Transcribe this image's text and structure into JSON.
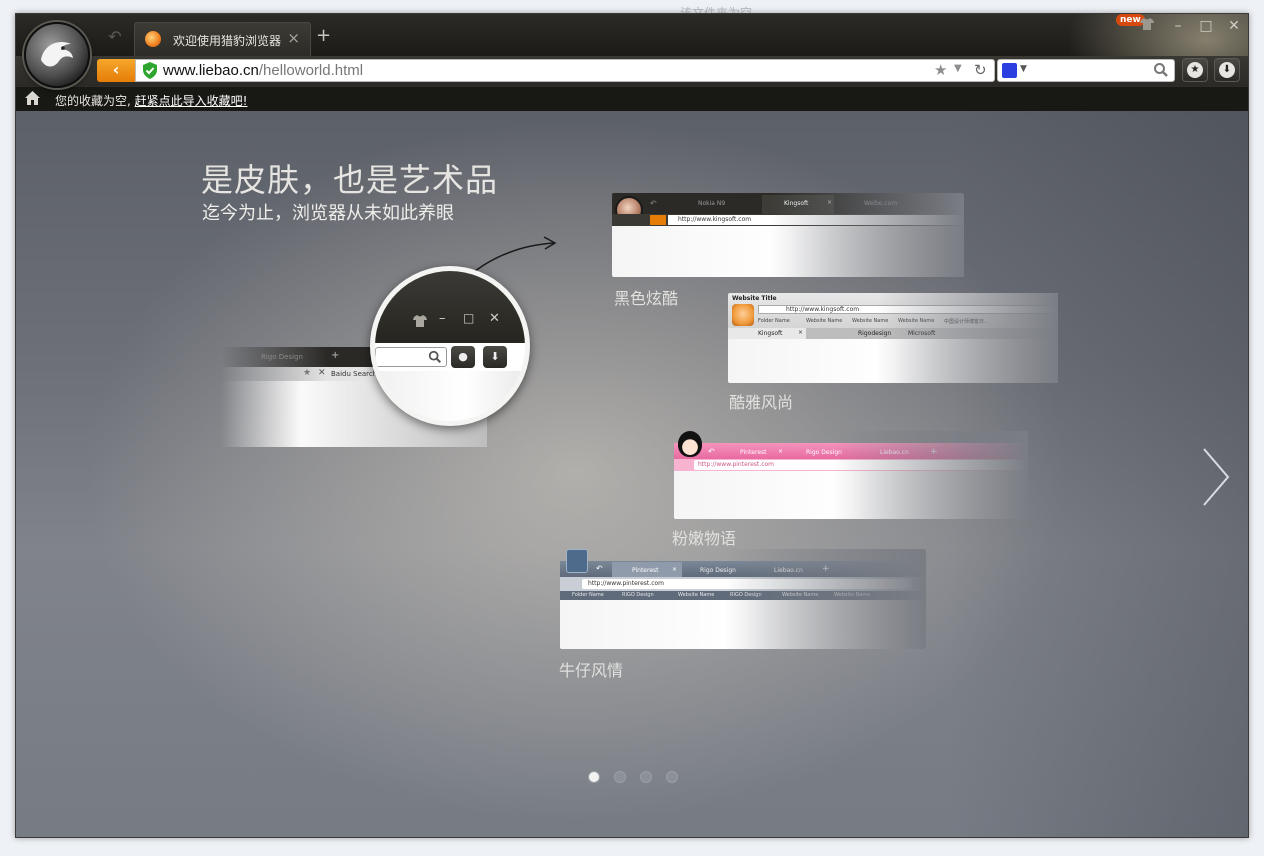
{
  "background_window_title": "该文件夹为空",
  "browser": {
    "tab": {
      "title": "欢迎使用猎豹浏览器"
    },
    "new_badge": "new",
    "address": {
      "host": "www.liebao.cn",
      "path": "/helloworld.html"
    },
    "bookmark_bar": {
      "empty_text": "您的收藏为空,",
      "import_link": "赶紧点此导入收藏吧!"
    }
  },
  "hero": {
    "headline": "是皮肤，也是艺术品",
    "subheadline": "迄今为止，浏览器从未如此养眼"
  },
  "magnifier_preview": {
    "tab_label": "Rigo Design",
    "search_label": "Baidu Search"
  },
  "skins": [
    {
      "name": "黑色炫酷",
      "tabs": [
        "Nokia N9",
        "Kingsoft",
        "Weibo.com"
      ],
      "url": "http://www.kingsoft.com"
    },
    {
      "name": "酷雅风尚",
      "window_title": "Website Title",
      "url": "http://www.kingsoft.com",
      "bookmarks": [
        "Folder Name",
        "Website Name",
        "Website Name",
        "Website Name",
        "中国设计师博客日..."
      ],
      "tabs": [
        "Kingsoft",
        "Rigodesign",
        "Microsoft"
      ]
    },
    {
      "name": "粉嫩物语",
      "tabs": [
        "Pinterest",
        "Rigo Design",
        "Liebao.cn"
      ],
      "url": "http://www.pinterest.com"
    },
    {
      "name": "牛仔风情",
      "tabs": [
        "Pinterest",
        "Rigo Design",
        "Liebao.cn"
      ],
      "url": "http://www.pinterest.com",
      "bookmarks": [
        "Folder Name",
        "RIGO Design",
        "Website Name",
        "RIGO Design",
        "Website Name",
        "Website Name"
      ]
    }
  ],
  "pager": {
    "page_count": 4,
    "active_index": 0
  },
  "colors": {
    "accent_orange": "#e67d07",
    "chrome_dark": "#1d1c19",
    "pink_skin": "#e86aa0",
    "denim_skin": "#6b7a8a"
  },
  "icons": [
    "cheetah-logo-icon",
    "back-icon",
    "close-icon",
    "plus-icon",
    "shirt-icon",
    "minimize-icon",
    "maximize-icon",
    "shield-check-icon",
    "star-icon",
    "refresh-icon",
    "search-icon",
    "home-icon",
    "chevron-right-icon",
    "download-icon"
  ]
}
